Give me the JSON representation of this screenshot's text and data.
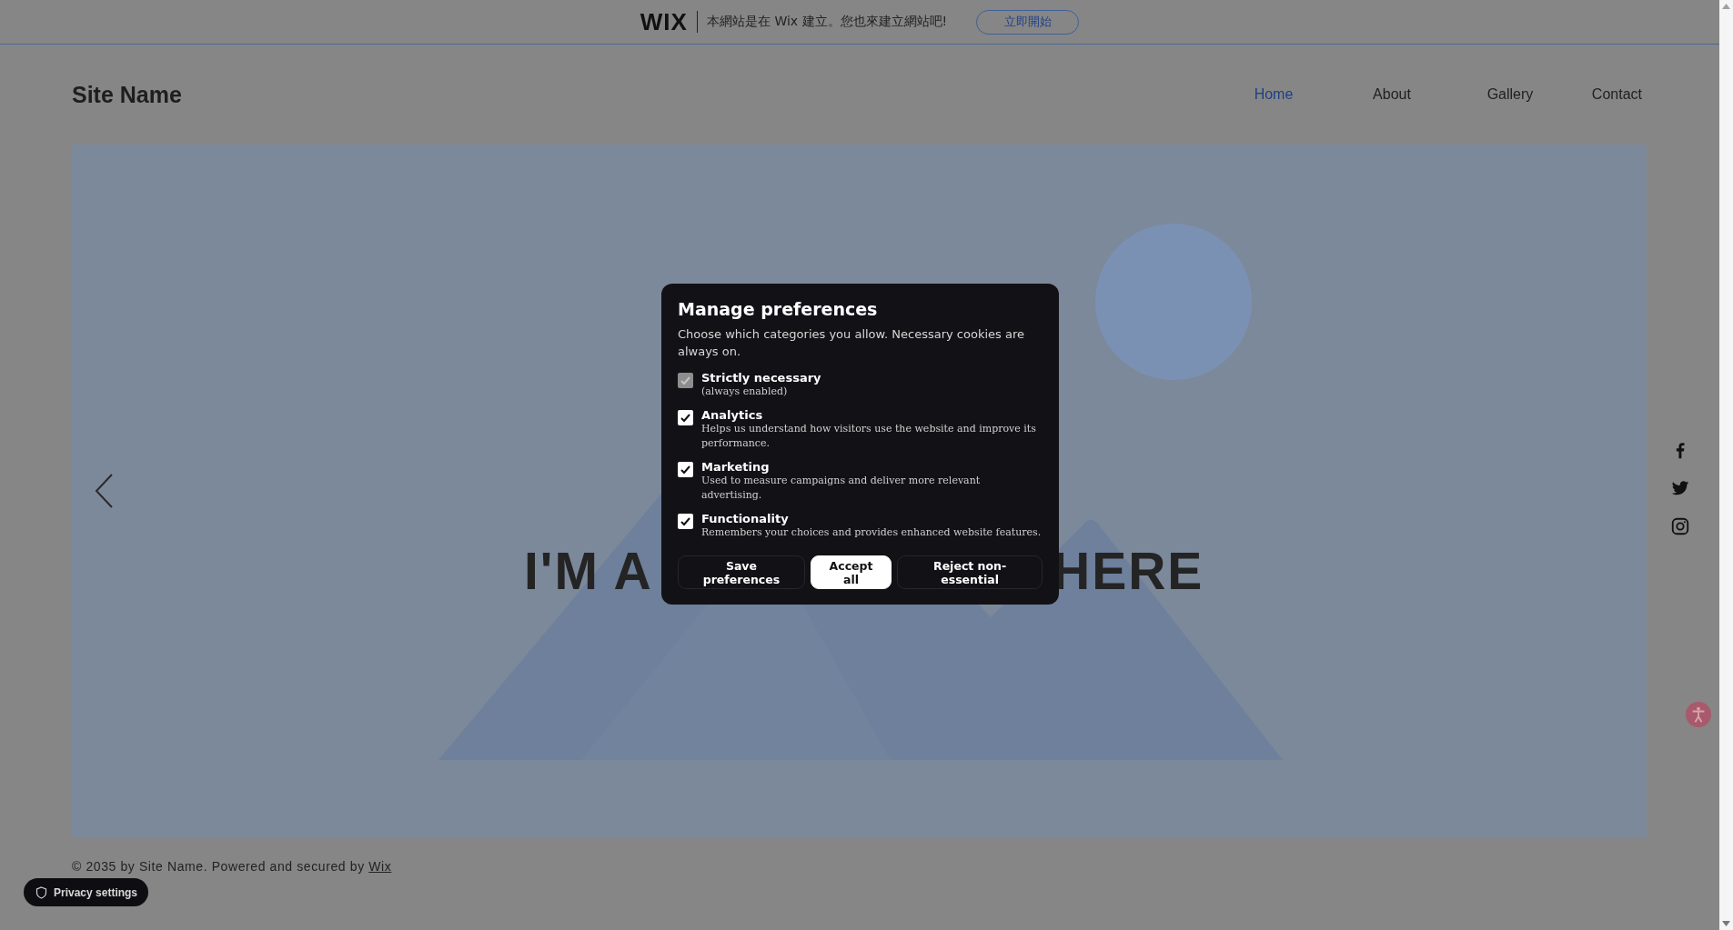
{
  "banner": {
    "logo": "WIX",
    "message": "本網站是在 Wix 建立。您也來建立網站吧!",
    "button": "立即開始"
  },
  "header": {
    "site_name": "Site Name",
    "nav": [
      {
        "label": "Home",
        "selected": true
      },
      {
        "label": "About",
        "selected": false
      },
      {
        "label": "Gallery",
        "selected": false
      },
      {
        "label": "Contact",
        "selected": false
      }
    ]
  },
  "hero": {
    "title_left": "I'M A",
    "title_right": "HERE"
  },
  "dialog": {
    "title": "Manage preferences",
    "description": "Choose which categories you allow. Necessary cookies are always on.",
    "categories": [
      {
        "title": "Strictly necessary",
        "description": "(always enabled)",
        "checked": true,
        "disabled": true
      },
      {
        "title": "Analytics",
        "description": "Helps us understand how visitors use the website and improve its performance.",
        "checked": true,
        "disabled": false
      },
      {
        "title": "Marketing",
        "description": "Used to measure campaigns and deliver more relevant advertising.",
        "checked": true,
        "disabled": false
      },
      {
        "title": "Functionality",
        "description": "Remembers your choices and provides enhanced website features.",
        "checked": true,
        "disabled": false
      }
    ],
    "buttons": [
      {
        "label": "Save preferences",
        "kind": "secondary"
      },
      {
        "label": "Accept all",
        "kind": "primary"
      },
      {
        "label": "Reject non-essential",
        "kind": "secondary"
      }
    ]
  },
  "footer": {
    "text": "© 2035 by Site Name. Powered and secured by",
    "link": "Wix"
  },
  "privacy_button": "Privacy settings"
}
